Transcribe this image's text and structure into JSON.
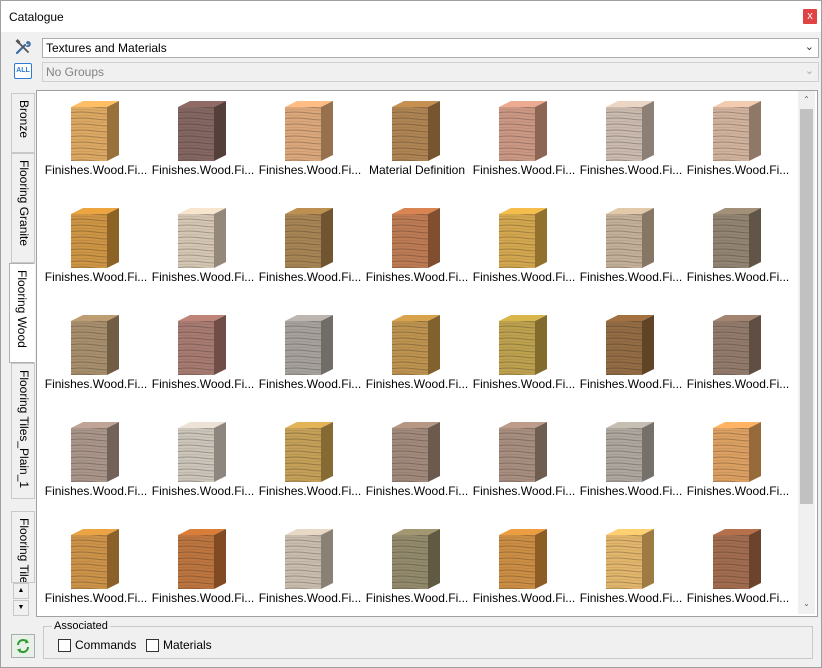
{
  "window": {
    "title": "Catalogue",
    "close_label": "x",
    "close_color": "#e04343"
  },
  "toolbar": {
    "tools_icon": "wrench-screwdriver-icon",
    "all_icon_label": "ALL",
    "catalog_select": {
      "value": "Textures and Materials",
      "arrow": "⌄"
    },
    "group_select": {
      "value": "No Groups",
      "arrow": "⌄",
      "disabled": true
    }
  },
  "side_tabs": [
    {
      "label": "Bronze",
      "active": false
    },
    {
      "label": "Flooring Granite",
      "active": false
    },
    {
      "label": "Flooring Wood",
      "active": true
    },
    {
      "label": "Flooring Tiles_Plain_1",
      "active": false
    },
    {
      "label": "Flooring Tile",
      "active": false
    }
  ],
  "tab_scroll": {
    "up": "▲",
    "down": "▼"
  },
  "grid": {
    "items": [
      {
        "label": "Finishes.Wood.Fi...",
        "color": "#d9a155"
      },
      {
        "label": "Finishes.Wood.Fi...",
        "color": "#7a5a55"
      },
      {
        "label": "Finishes.Wood.Fi...",
        "color": "#d8a070"
      },
      {
        "label": "Material Definition",
        "color": "#a87a45"
      },
      {
        "label": "Finishes.Wood.Fi...",
        "color": "#c8907a"
      },
      {
        "label": "Finishes.Wood.Fi...",
        "color": "#c7b5a8"
      },
      {
        "label": "Finishes.Wood.Fi...",
        "color": "#ceac95"
      },
      {
        "label": "Finishes.Wood.Fi...",
        "color": "#c98c35"
      },
      {
        "label": "Finishes.Wood.Fi...",
        "color": "#d2c2ae"
      },
      {
        "label": "Finishes.Wood.Fi...",
        "color": "#a07a45"
      },
      {
        "label": "Finishes.Wood.Fi...",
        "color": "#b87045"
      },
      {
        "label": "Finishes.Wood.Fi...",
        "color": "#d0a040"
      },
      {
        "label": "Finishes.Wood.Fi...",
        "color": "#bfaa90"
      },
      {
        "label": "Finishes.Wood.Fi...",
        "color": "#8a7a66"
      },
      {
        "label": "Finishes.Wood.Fi...",
        "color": "#a08560"
      },
      {
        "label": "Finishes.Wood.Fi...",
        "color": "#a07065"
      },
      {
        "label": "Finishes.Wood.Fi...",
        "color": "#a09a95"
      },
      {
        "label": "Finishes.Wood.Fi...",
        "color": "#b88a40"
      },
      {
        "label": "Finishes.Wood.Fi...",
        "color": "#b89a40"
      },
      {
        "label": "Finishes.Wood.Fi...",
        "color": "#8a6035"
      },
      {
        "label": "Finishes.Wood.Fi...",
        "color": "#8a7060"
      },
      {
        "label": "Finishes.Wood.Fi...",
        "color": "#a38c80"
      },
      {
        "label": "Finishes.Wood.Fi...",
        "color": "#c8c0b5"
      },
      {
        "label": "Finishes.Wood.Fi...",
        "color": "#c0984a"
      },
      {
        "label": "Finishes.Wood.Fi...",
        "color": "#9a8070"
      },
      {
        "label": "Finishes.Wood.Fi...",
        "color": "#a08575"
      },
      {
        "label": "Finishes.Wood.Fi...",
        "color": "#a8a098"
      },
      {
        "label": "Finishes.Wood.Fi...",
        "color": "#d89855"
      },
      {
        "label": "Finishes.Wood.Fi...",
        "color": "#c88a3a"
      },
      {
        "label": "Finishes.Wood.Fi...",
        "color": "#b86a30"
      },
      {
        "label": "Finishes.Wood.Fi...",
        "color": "#c5b8a8"
      },
      {
        "label": "Finishes.Wood.Fi...",
        "color": "#8a8060"
      },
      {
        "label": "Finishes.Wood.Fi...",
        "color": "#c88535"
      },
      {
        "label": "Finishes.Wood.Fi...",
        "color": "#e0b060"
      },
      {
        "label": "Finishes.Wood.Fi...",
        "color": "#9a6040"
      }
    ]
  },
  "scrollbar": {
    "up": "⌃",
    "down": "⌄"
  },
  "footer": {
    "refresh_icon": "refresh-icon",
    "group_title": "Associated",
    "commands_label": "Commands",
    "materials_label": "Materials"
  }
}
